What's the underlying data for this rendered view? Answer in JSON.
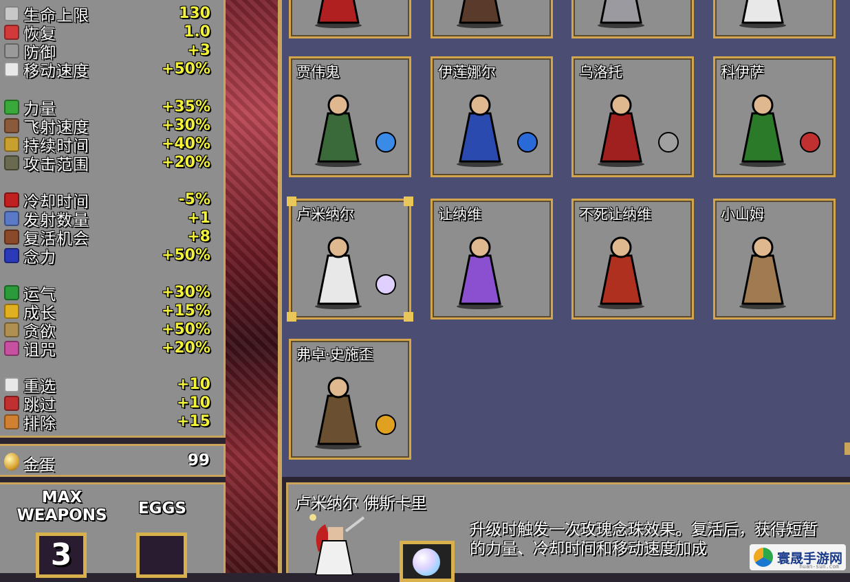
{
  "stats": {
    "groups": [
      [
        {
          "label": "生命上限",
          "value": "130",
          "icon": "heart-icon",
          "color": "#c8c8c8"
        },
        {
          "label": "恢复",
          "value": "1.0",
          "icon": "heart-regen-icon",
          "color": "#d23a3a"
        },
        {
          "label": "防御",
          "value": "+3",
          "icon": "armor-icon",
          "color": "#9a9a9a"
        },
        {
          "label": "移动速度",
          "value": "+50%",
          "icon": "wing-icon",
          "color": "#e8e8e8"
        }
      ],
      [
        {
          "label": "力量",
          "value": "+35%",
          "icon": "might-icon",
          "color": "#3aa83a"
        },
        {
          "label": "飞射速度",
          "value": "+30%",
          "icon": "speed-icon",
          "color": "#8a5a3a"
        },
        {
          "label": "持续时间",
          "value": "+40%",
          "icon": "duration-icon",
          "color": "#c8a030"
        },
        {
          "label": "攻击范围",
          "value": "+20%",
          "icon": "area-icon",
          "color": "#6a6a50"
        }
      ],
      [
        {
          "label": "冷却时间",
          "value": "-5%",
          "icon": "cooldown-icon",
          "color": "#c02020"
        },
        {
          "label": "发射数量",
          "value": "+1",
          "icon": "amount-icon",
          "color": "#5a7ac8"
        },
        {
          "label": "复活机会",
          "value": "+8",
          "icon": "revival-icon",
          "color": "#8a4a2a"
        },
        {
          "label": "念力",
          "value": "+50%",
          "icon": "magnet-icon",
          "color": "#2a3ab8"
        }
      ],
      [
        {
          "label": "运气",
          "value": "+30%",
          "icon": "clover-icon",
          "color": "#2a9a3a"
        },
        {
          "label": "成长",
          "value": "+15%",
          "icon": "crown-icon",
          "color": "#e0b020"
        },
        {
          "label": "贪欲",
          "value": "+50%",
          "icon": "greed-icon",
          "color": "#b09050"
        },
        {
          "label": "诅咒",
          "value": "+20%",
          "icon": "skull-icon",
          "color": "#c850a0"
        }
      ],
      [
        {
          "label": "重选",
          "value": "+10",
          "icon": "reroll-icon",
          "color": "#e8e8e8"
        },
        {
          "label": "跳过",
          "value": "+10",
          "icon": "skip-icon",
          "color": "#c03030"
        },
        {
          "label": "排除",
          "value": "+15",
          "icon": "banish-icon",
          "color": "#d08030"
        }
      ]
    ]
  },
  "gold": {
    "label": "金蛋",
    "value": "99"
  },
  "counters": {
    "max_weapons_label": "MAX\nWEAPONS",
    "max_weapons_value": "3",
    "eggs_label": "EGGS",
    "eggs_value": ""
  },
  "characters": {
    "row0": [
      {
        "name": "",
        "color": "#b02020"
      },
      {
        "name": "",
        "color": "#5a3a2a"
      },
      {
        "name": "",
        "color": "#9a9aa0"
      },
      {
        "name": "",
        "color": "#e8e8e8"
      }
    ],
    "row1": [
      {
        "name": "贾伟鬼",
        "color": "#3a6a3a",
        "weapon": "blue-orbs",
        "weapon_color": "#3a8ae8"
      },
      {
        "name": "伊莲娜尔",
        "color": "#2a4ab0",
        "weapon": "staff-s",
        "weapon_color": "#2a6ad8"
      },
      {
        "name": "乌洛托",
        "color": "#a02020",
        "weapon": "sword",
        "weapon_color": "#a0a0a0"
      },
      {
        "name": "科伊萨",
        "color": "#2a7a2a",
        "weapon": "arrow",
        "weapon_color": "#c03030"
      }
    ],
    "row2": [
      {
        "name": "卢米纳尔",
        "color": "#e8e8e8",
        "weapon": "rainbow-orb",
        "weapon_color": "#e0d0ff",
        "selected": true
      },
      {
        "name": "让纳维",
        "color": "#8a50d0",
        "weapon": "",
        "weapon_color": ""
      },
      {
        "name": "不死让纳维",
        "color": "#b03020",
        "weapon": "",
        "weapon_color": ""
      },
      {
        "name": "小山姆",
        "color": "#a07a50",
        "weapon": "",
        "weapon_color": ""
      }
    ],
    "row3": [
      {
        "name": "弗卓·史施歪",
        "color": "#6a5030",
        "weapon": "party-horn",
        "weapon_color": "#e0a020"
      }
    ]
  },
  "detail": {
    "name": "卢米纳尔 佛斯卡里",
    "description": "升级时触发一次玫瑰念珠效果。复活后，获得短暂的力量、冷却时间和移动速度加成"
  },
  "watermark": {
    "text": "寰晟手游网",
    "sub": "huan-sun.com"
  }
}
